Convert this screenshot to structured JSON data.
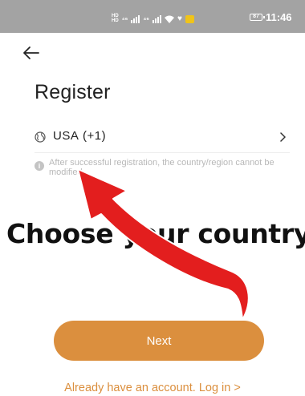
{
  "status_bar": {
    "network_left": "HD",
    "network_sub": "s",
    "signal_1": "⁴⁶",
    "signal_2": "⁴⁶",
    "battery": "87",
    "time": "11:46"
  },
  "header": {
    "title": "Register"
  },
  "country": {
    "label": "USA (+1)"
  },
  "notice": {
    "text": "After successful registration, the country/region cannot be modified"
  },
  "overlay": {
    "caption": "Choose your country",
    "arrow_color": "#e31e1e"
  },
  "actions": {
    "next_label": "Next",
    "login_label": "Already have an account. Log in >"
  },
  "colors": {
    "accent": "#db8f3e",
    "status_bar": "#a3a3a3"
  }
}
